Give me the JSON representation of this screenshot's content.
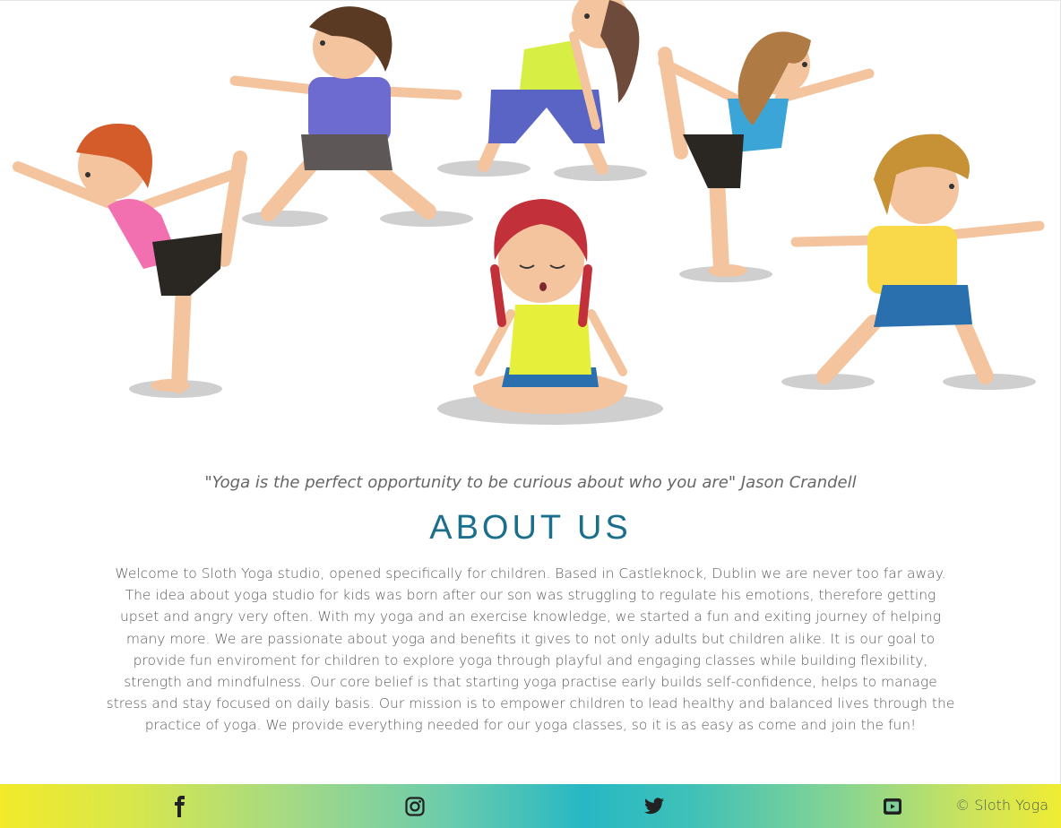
{
  "quote": "\"Yoga is the perfect opportunity to be curious about who you are\" Jason Crandell",
  "about": {
    "title": "ABOUT US",
    "text": "Welcome to Sloth Yoga studio, opened specifically for children. Based in Castleknock, Dublin we are never too far away. The idea about yoga studio for kids was born after our son was struggling to regulate his emotions, therefore getting upset and angry very often. With my yoga and an exercise knowledge, we started a fun and exiting journey of helping many more. We are passionate about yoga and benefits it gives to not only adults but children alike. It is our goal to provide fun enviroment for children to explore yoga through playful and engaging classes while building flexibility, strength and mindfulness. Our core belief is that starting yoga practise early builds self-confidence, helps to manage stress and stay focused on daily basis. Our mission is to empower children to lead healthy and balanced lives through the practice of yoga. We provide everything needed for our yoga classes, so it is as easy as come and join the fun!"
  },
  "footer": {
    "social": [
      {
        "name": "facebook-icon"
      },
      {
        "name": "instagram-icon"
      },
      {
        "name": "twitter-icon"
      },
      {
        "name": "youtube-icon"
      }
    ],
    "copyright": "© Sloth Yoga"
  },
  "colors": {
    "heading": "#1c6f8c",
    "footer_gradient": [
      "#f2ea2a",
      "#27b8c4",
      "#efec33"
    ]
  }
}
